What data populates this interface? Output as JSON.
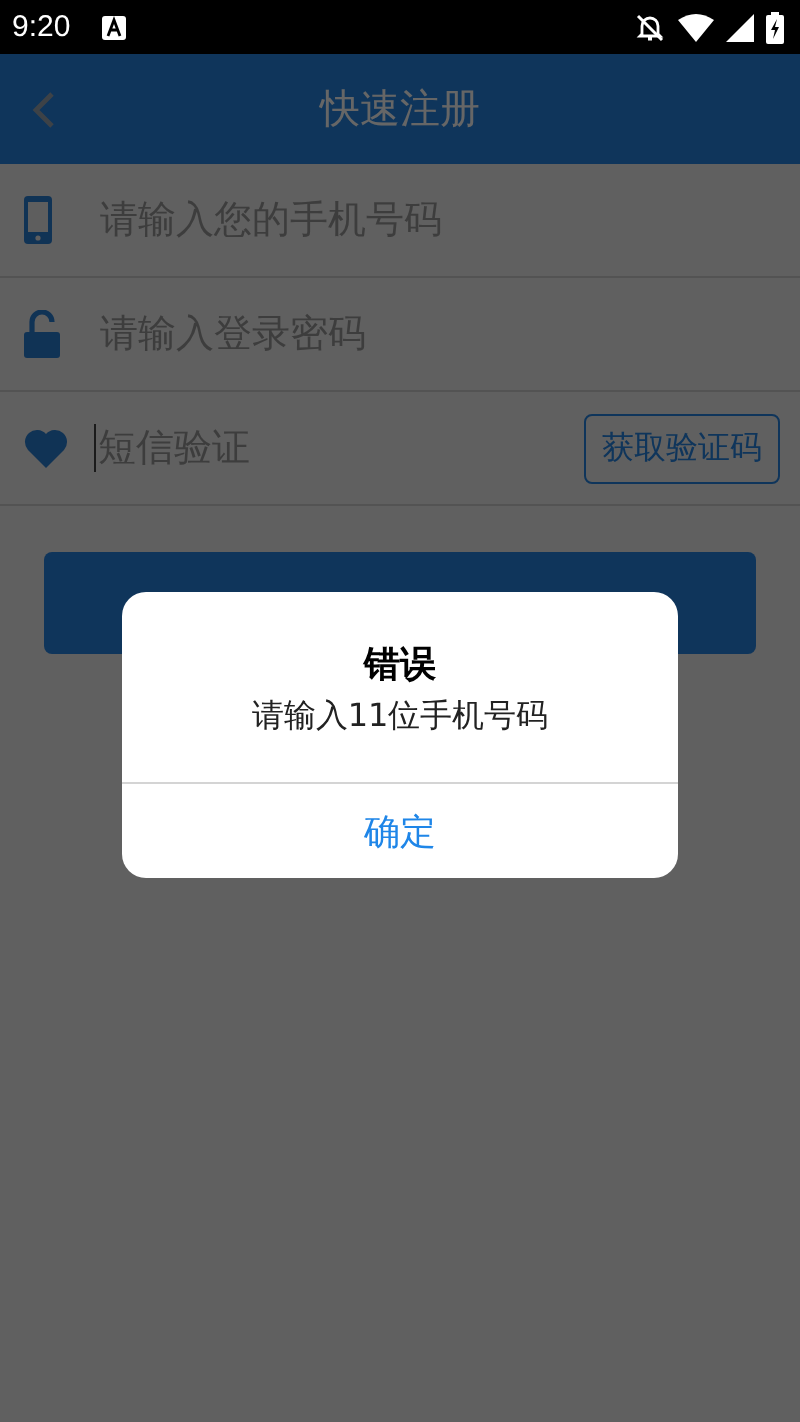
{
  "status_bar": {
    "time": "9:20"
  },
  "header": {
    "title": "快速注册"
  },
  "fields": [
    {
      "kind": "phone",
      "placeholder": "请输入您的手机号码",
      "focused": false
    },
    {
      "kind": "password",
      "placeholder": "请输入登录密码",
      "focused": false
    },
    {
      "kind": "sms",
      "placeholder": "短信验证",
      "focused": true,
      "button": "获取验证码"
    }
  ],
  "dialog": {
    "title": "错误",
    "message": "请输入11位手机号码",
    "button": "确定"
  }
}
